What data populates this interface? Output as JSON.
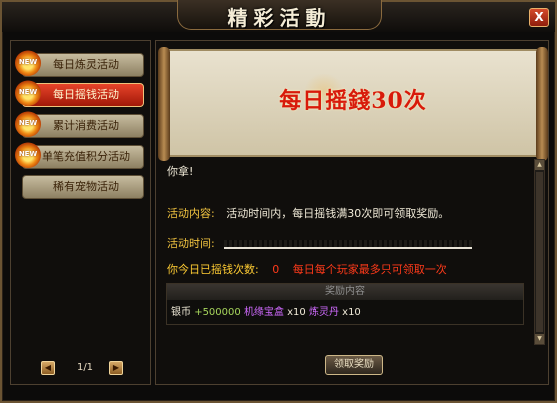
{
  "window": {
    "title": "精彩活動",
    "close_label": "X"
  },
  "sidebar": {
    "badge": "NEW",
    "items": [
      {
        "label": "每日炼灵活动",
        "new": true,
        "active": false
      },
      {
        "label": "每日摇钱活动",
        "new": true,
        "active": true
      },
      {
        "label": "累计消费活动",
        "new": true,
        "active": false
      },
      {
        "label": "单笔充值积分活动",
        "new": true,
        "active": false
      },
      {
        "label": "稀有宠物活动",
        "new": false,
        "active": false
      }
    ],
    "pager": {
      "prev": "◀",
      "next": "▶",
      "text": "1/1"
    }
  },
  "detail": {
    "banner_title": "每日摇錢30次",
    "greeting": "你拿!",
    "content_label": "活动内容:",
    "content_text": "活动时间内，每日摇钱满30次即可领取奖励。",
    "time_label": "活动时间:",
    "count_label": "你今日已摇钱次数:",
    "count_value": "0",
    "limit_note": "每日每个玩家最多只可领取一次",
    "reward_header": "奖励内容",
    "reward_currency": "银币",
    "reward_amount": "+500000",
    "reward_item1": "机缘宝盒",
    "reward_qty1": "x10",
    "reward_item2": "炼灵丹",
    "reward_qty2": "x10",
    "claim_label": "领取奖励"
  }
}
